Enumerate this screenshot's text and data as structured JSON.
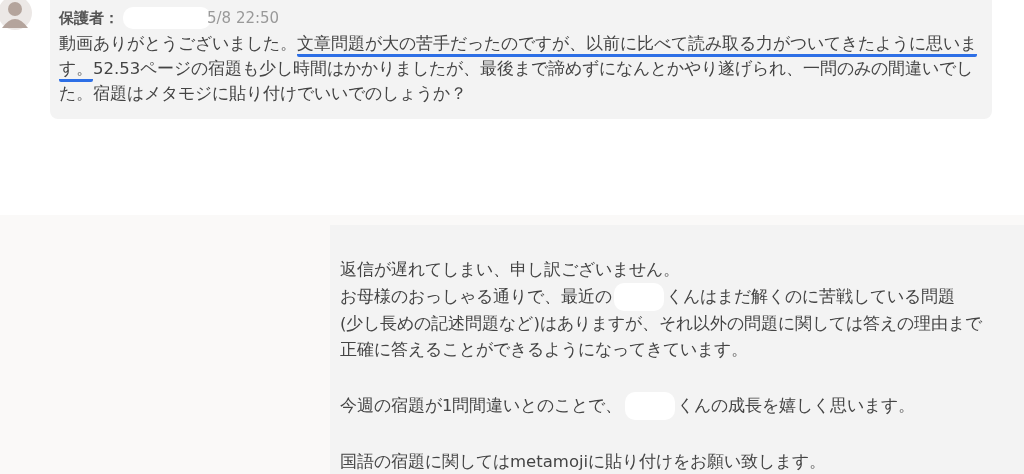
{
  "messages": [
    {
      "kind": "incoming",
      "sender": "保護者：",
      "sender_hidden": true,
      "time": "5/8 22:50",
      "lines": [
        {
          "kind": "text",
          "segments": [
            {
              "text": "動画ありがとうございました。",
              "underlined": false
            },
            {
              "text": "文章問題が大の苦手だったのですが、以前に比べて読み取る力がついてきたように思いま",
              "underlined": true
            }
          ]
        },
        {
          "kind": "text",
          "segments": [
            {
              "text": "す。",
              "underlined": true
            },
            {
              "text": "52.53ページの宿題も少し時間はかかりましたが、最後まで諦めずになんとかやり遂げられ、一問のみの間違いでし",
              "underlined": false
            }
          ]
        },
        {
          "kind": "text",
          "segments": [
            {
              "text": "た。宿題はメタモジに貼り付けでいいでのしょうか？",
              "underlined": false
            }
          ]
        }
      ]
    },
    {
      "kind": "outgoing",
      "lines": [
        {
          "kind": "text",
          "segments": [
            {
              "text": "返信が遅れてしまい、申し訳ございません。",
              "underlined": false
            }
          ]
        },
        {
          "kind": "text",
          "segments": [
            {
              "text": "お母様のおっしゃる通りで、最近の",
              "underlined": false
            },
            {
              "kind": "redacted"
            },
            {
              "text": "くんはまだ解くのに苦戦している問題",
              "underlined": false
            }
          ]
        },
        {
          "kind": "text",
          "segments": [
            {
              "text": "(少し長めの記述問題など)はありますが、それ以外の問題に関しては答えの理由まで",
              "underlined": false
            }
          ]
        },
        {
          "kind": "text",
          "segments": [
            {
              "text": "正確に答えることができるようになってきています。",
              "underlined": false
            }
          ]
        },
        {
          "kind": "blank"
        },
        {
          "kind": "text",
          "segments": [
            {
              "text": "今週の宿題が1問間違いとのことで、",
              "underlined": false
            },
            {
              "kind": "redacted"
            },
            {
              "text": "くんの成長を嬉しく思います。",
              "underlined": false
            }
          ]
        },
        {
          "kind": "blank"
        },
        {
          "kind": "text",
          "segments": [
            {
              "text": "国語の宿題に関してはmetamojiに貼り付けをお願い致します。",
              "underlined": false
            }
          ]
        }
      ]
    }
  ]
}
